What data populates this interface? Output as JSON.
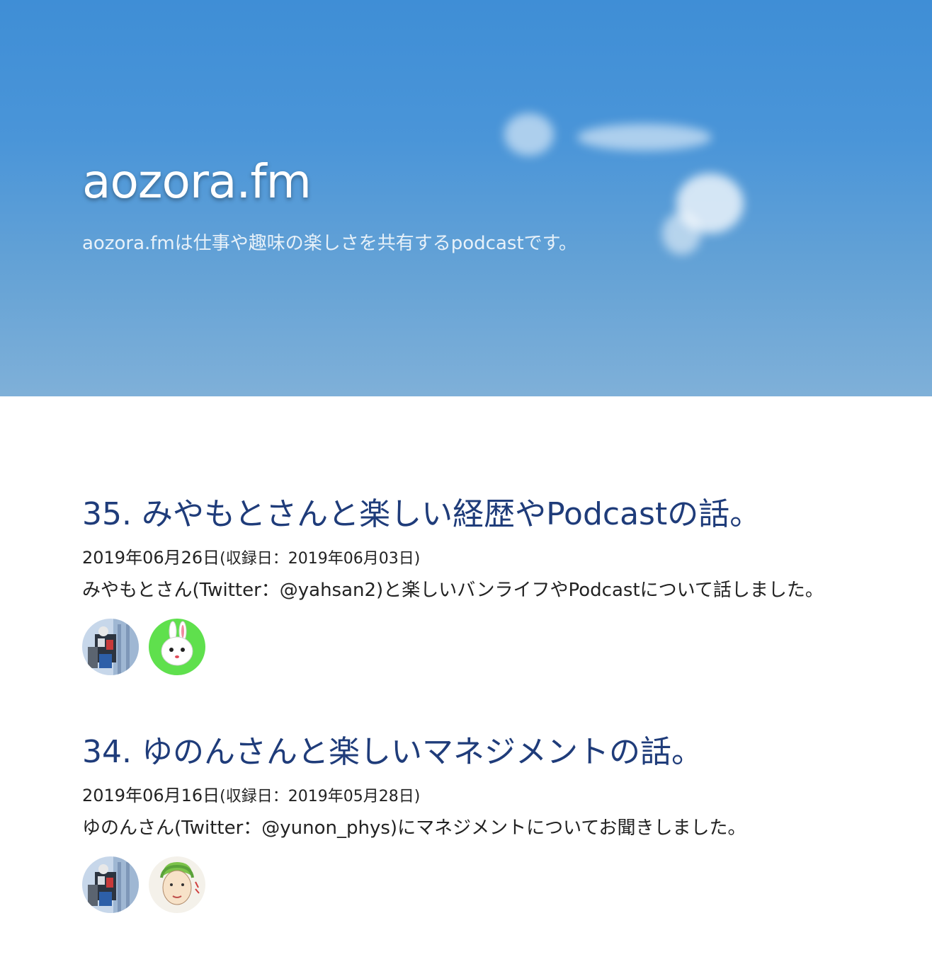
{
  "site": {
    "title": "aozora.fm",
    "description": "aozora.fmは仕事や趣味の楽しさを共有するpodcastです。"
  },
  "episodes": [
    {
      "title": "35. みやもとさんと楽しい経歴やPodcastの話。",
      "date": "2019年06月26日",
      "recorded": "(収録日：2019年06月03日)",
      "summary": "みやもとさん(Twitter：@yahsan2)と楽しいバンライフやPodcastについて話しました。",
      "avatars": [
        "host-avatar",
        "rabbit-avatar"
      ]
    },
    {
      "title": "34. ゆのんさんと楽しいマネジメントの話。",
      "date": "2019年06月16日",
      "recorded": "(収録日：2019年05月28日)",
      "summary": "ゆのんさん(Twitter：@yunon_phys)にマネジメントについてお聞きしました。",
      "avatars": [
        "host-avatar",
        "sketch-face-avatar"
      ]
    }
  ],
  "colors": {
    "sky_top": "#3f8ed6",
    "sky_bottom": "#7fb0d8",
    "link": "#1f3c7a",
    "text": "#222222"
  }
}
